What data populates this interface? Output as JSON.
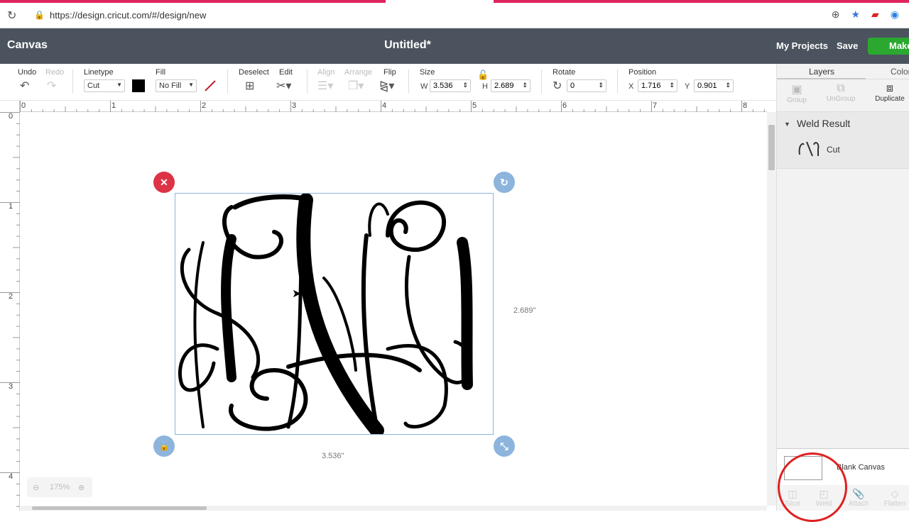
{
  "browser": {
    "url": "https://design.cricut.com/#/design/new"
  },
  "app": {
    "brand": "Canvas",
    "doc_title": "Untitled*",
    "my_projects": "My Projects",
    "save": "Save",
    "make": "Make"
  },
  "toolbar": {
    "undo": "Undo",
    "redo": "Redo",
    "linetype": "Linetype",
    "linetype_value": "Cut",
    "fill": "Fill",
    "fill_value": "No Fill",
    "deselect": "Deselect",
    "edit": "Edit",
    "align": "Align",
    "arrange": "Arrange",
    "flip": "Flip",
    "size": "Size",
    "w_label": "W",
    "w_value": "3.536",
    "h_label": "H",
    "h_value": "2.689",
    "rotate": "Rotate",
    "rotate_value": "0",
    "position": "Position",
    "x_label": "X",
    "x_value": "1.716",
    "y_label": "Y",
    "y_value": "0.901"
  },
  "ruler": {
    "top": [
      "0",
      "1",
      "2",
      "3",
      "4",
      "5",
      "6",
      "7",
      "8"
    ],
    "left": [
      "0",
      "1",
      "2",
      "3",
      "4"
    ]
  },
  "canvas": {
    "width_label": "3.536\"",
    "height_label": "2.689\"",
    "zoom": "175%"
  },
  "sidebar": {
    "tabs": [
      "Layers",
      "Color"
    ],
    "tools": [
      "Group",
      "UnGroup",
      "Duplicate"
    ],
    "layer_group": "Weld Result",
    "layer_item": "Cut",
    "blank_canvas": "Blank Canvas",
    "bottom_tools": [
      "Slice",
      "Weld",
      "Attach",
      "Flatten"
    ]
  }
}
